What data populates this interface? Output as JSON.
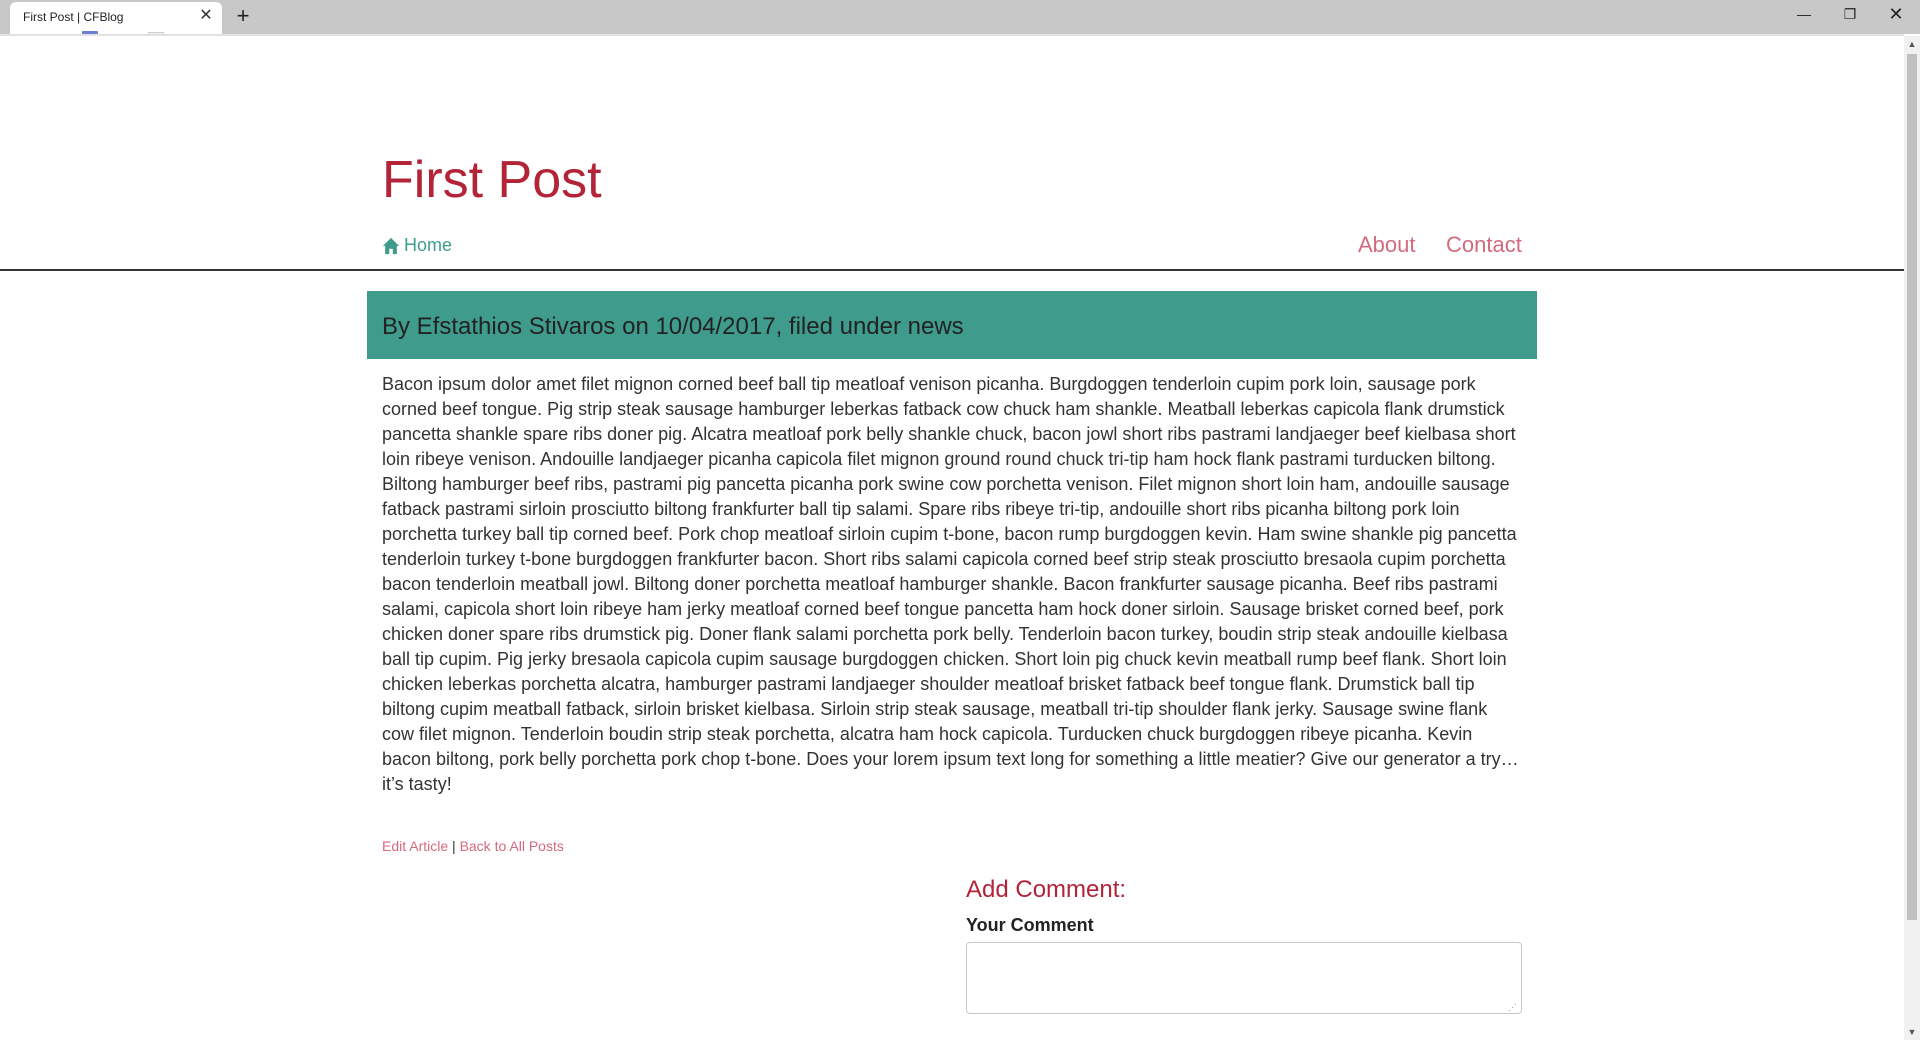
{
  "browser": {
    "tab_title": "First Post | CFBlog",
    "close_glyph": "✕",
    "new_tab_glyph": "+",
    "minimize_glyph": "—",
    "maximize_glyph": "❐",
    "window_close_glyph": "✕"
  },
  "header": {
    "title": "First Post",
    "nav": {
      "home_label": "Home",
      "about_label": "About",
      "contact_label": "Contact"
    }
  },
  "post": {
    "byline": "By Efstathios Stivaros on 10/04/2017, filed under news",
    "body": "Bacon ipsum dolor amet filet mignon corned beef ball tip meatloaf venison picanha. Burgdoggen tenderloin cupim pork loin, sausage pork corned beef tongue. Pig strip steak sausage hamburger leberkas fatback cow chuck ham shankle. Meatball leberkas capicola flank drumstick pancetta shankle spare ribs doner pig. Alcatra meatloaf pork belly shankle chuck, bacon jowl short ribs pastrami landjaeger beef kielbasa short loin ribeye venison. Andouille landjaeger picanha capicola filet mignon ground round chuck tri-tip ham hock flank pastrami turducken biltong. Biltong hamburger beef ribs, pastrami pig pancetta picanha pork swine cow porchetta venison. Filet mignon short loin ham, andouille sausage fatback pastrami sirloin prosciutto biltong frankfurter ball tip salami. Spare ribs ribeye tri-tip, andouille short ribs picanha biltong pork loin porchetta turkey ball tip corned beef. Pork chop meatloaf sirloin cupim t-bone, bacon rump burgdoggen kevin. Ham swine shankle pig pancetta tenderloin turkey t-bone burgdoggen frankfurter bacon. Short ribs salami capicola corned beef strip steak prosciutto bresaola cupim porchetta bacon tenderloin meatball jowl. Biltong doner porchetta meatloaf hamburger shankle. Bacon frankfurter sausage picanha. Beef ribs pastrami salami, capicola short loin ribeye ham jerky meatloaf corned beef tongue pancetta ham hock doner sirloin. Sausage brisket corned beef, pork chicken doner spare ribs drumstick pig. Doner flank salami porchetta pork belly. Tenderloin bacon turkey, boudin strip steak andouille kielbasa ball tip cupim. Pig jerky bresaola capicola cupim sausage burgdoggen chicken. Short loin pig chuck kevin meatball rump beef flank. Short loin chicken leberkas porchetta alcatra, hamburger pastrami landjaeger shoulder meatloaf brisket fatback beef tongue flank. Drumstick ball tip biltong cupim meatball fatback, sirloin brisket kielbasa. Sirloin strip steak sausage, meatball tri-tip shoulder flank jerky. Sausage swine flank cow filet mignon. Tenderloin boudin strip steak porchetta, alcatra ham hock capicola. Turducken chuck burgdoggen ribeye picanha. Kevin bacon biltong, pork belly porchetta pork chop t-bone. Does your lorem ipsum text long for something a little meatier? Give our generator a try… it’s tasty!",
    "edit_label": "Edit Article",
    "separator": "|",
    "back_label": "Back to All Posts"
  },
  "comments": {
    "heading": "Add Comment:",
    "field_label": "Your Comment",
    "field_value": ""
  },
  "colors": {
    "accent_red": "#b32438",
    "link_pink": "#d36a7e",
    "teal": "#3f9c8c"
  },
  "icons": {
    "home": "home-icon",
    "close": "close-icon"
  }
}
